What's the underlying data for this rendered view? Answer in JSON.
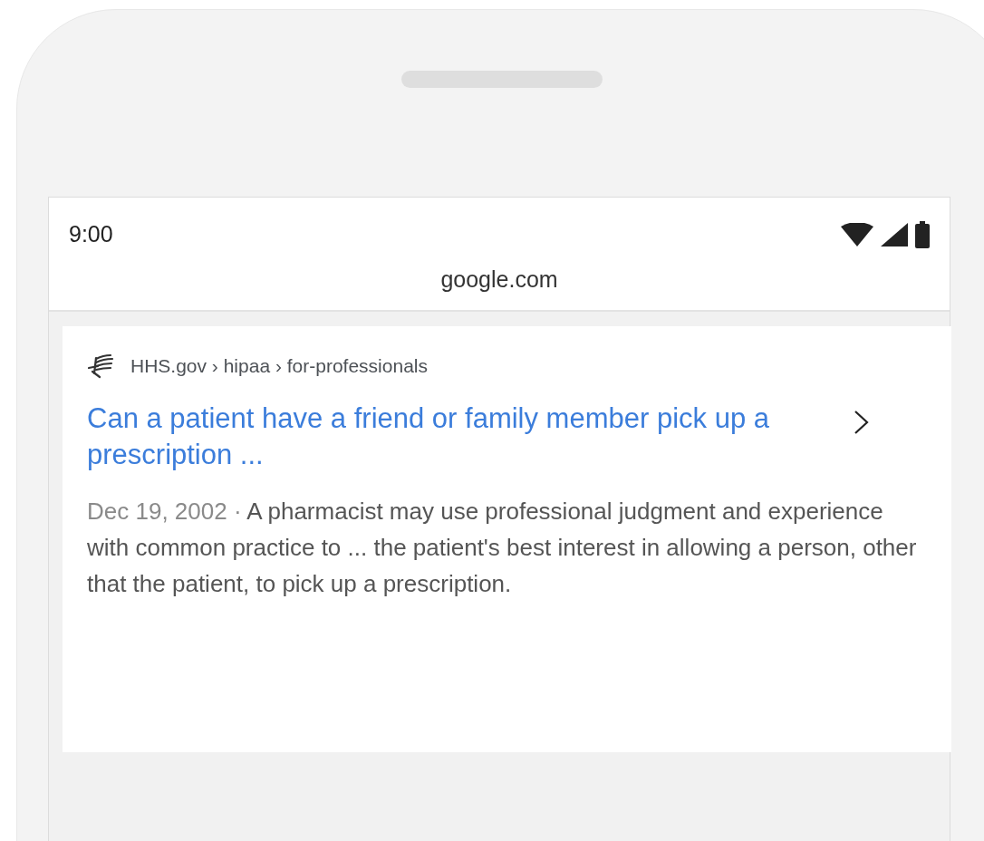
{
  "status_bar": {
    "time": "9:00"
  },
  "address_bar": {
    "url": "google.com"
  },
  "result": {
    "breadcrumb": "HHS.gov › hipaa › for-professionals",
    "title": "Can a patient have a friend or family member pick up a prescription ...",
    "date": "Dec 19, 2002 · ",
    "snippet": "A pharmacist may use professional judgment and experience with common practice to ... the patient's best interest in allowing a person, other that the patient, to pick up a prescription."
  }
}
